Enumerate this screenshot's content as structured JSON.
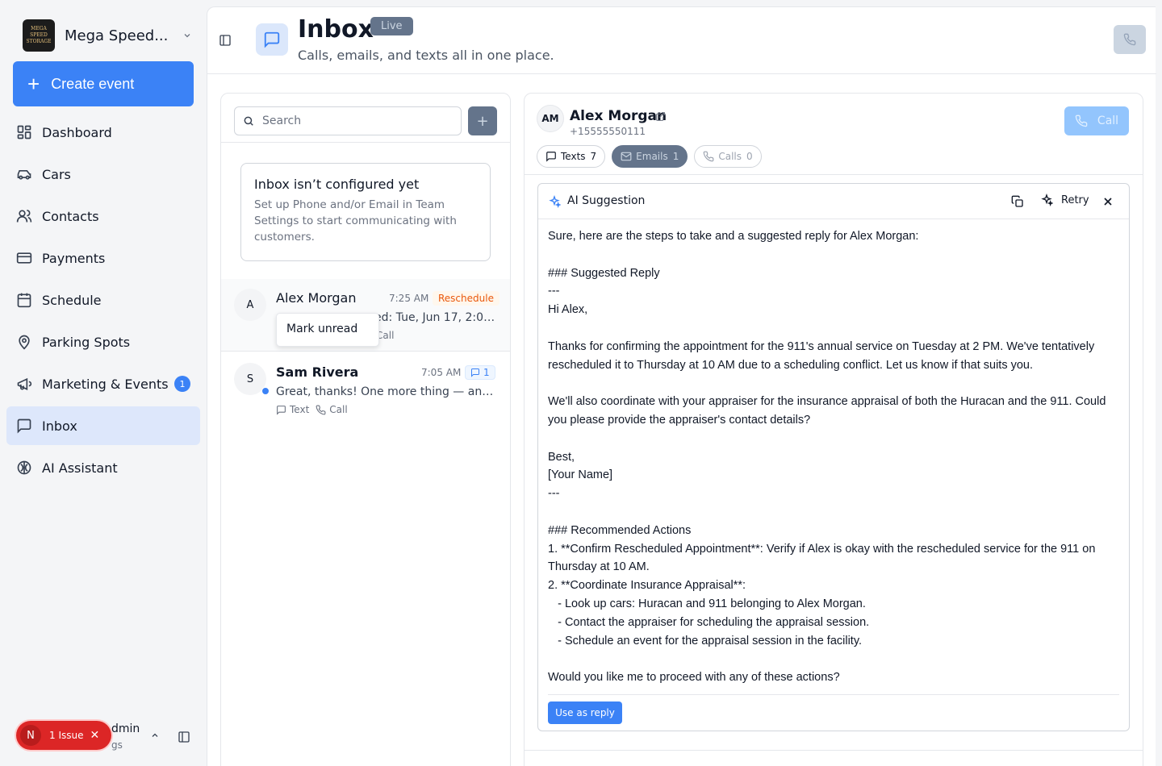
{
  "sidebar": {
    "brand_name": "Mega Speed...",
    "brand_logo_text": "MEGA SPEED STORAGE",
    "create_label": "Create event",
    "items": [
      {
        "label": "Dashboard",
        "icon": "dashboard-icon"
      },
      {
        "label": "Cars",
        "icon": "car-icon"
      },
      {
        "label": "Contacts",
        "icon": "contacts-icon"
      },
      {
        "label": "Payments",
        "icon": "credit-card-icon"
      },
      {
        "label": "Schedule",
        "icon": "calendar-icon"
      },
      {
        "label": "Parking Spots",
        "icon": "map-pin-icon"
      },
      {
        "label": "Marketing & Events",
        "icon": "megaphone-icon",
        "badge": "1"
      },
      {
        "label": "Inbox",
        "icon": "message-square-icon",
        "active": true
      },
      {
        "label": "AI Assistant",
        "icon": "brain-icon"
      }
    ],
    "issue": {
      "avatar": "N",
      "label": "1 Issue"
    },
    "user": {
      "name": "dmin",
      "sub": "gs"
    }
  },
  "header": {
    "title": "Inbox",
    "badge": "Live",
    "subtitle": "Calls, emails, and texts all in one place."
  },
  "list": {
    "search_placeholder": "Search",
    "add_label": "+",
    "config_card": {
      "title": "Inbox isn’t configured yet",
      "body": "Set up Phone and/or Email in Team Settings to start communicating with customers."
    },
    "conversations": [
      {
        "avatar": "A",
        "name": "Alex Morgan",
        "time": "7:25 AM",
        "tag": "Reschedule",
        "preview": "ed: Tue, Jun 17, 2:00 ...",
        "meta_fragment": "Call"
      },
      {
        "avatar": "S",
        "name": "Sam Rivera",
        "time": "7:05 AM",
        "count": "1",
        "preview": "Great, thanks! One more thing — any u...",
        "meta_text": "Text",
        "meta_call": "Call"
      }
    ],
    "context_menu": {
      "item": "Mark unread"
    }
  },
  "detail": {
    "avatar": "AM",
    "name": "Alex Morgan",
    "phone": "+15555550111",
    "call_label": "Call",
    "chips": [
      {
        "label": "Texts",
        "count": "7"
      },
      {
        "label": "Emails",
        "count": "1"
      },
      {
        "label": "Calls",
        "count": "0"
      }
    ],
    "ai": {
      "title": "AI Suggestion",
      "retry_label": "Retry",
      "use_label": "Use as reply",
      "text": "Sure, here are the steps to take and a suggested reply for Alex Morgan:\n\n### Suggested Reply\n---\nHi Alex,\n\nThanks for confirming the appointment for the 911's annual service on Tuesday at 2 PM. We've tentatively rescheduled it to Thursday at 10 AM due to a scheduling conflict. Let us know if that suits you.\n\nWe'll also coordinate with your appraiser for the insurance appraisal of both the Huracan and the 911. Could you please provide the appraiser's contact details?\n\nBest,\n[Your Name]\n---\n\n### Recommended Actions\n1. **Confirm Rescheduled Appointment**: Verify if Alex is okay with the rescheduled service for the 911 on Thursday at 10 AM.\n2. **Coordinate Insurance Appraisal**:\n   - Look up cars: Huracan and 911 belonging to Alex Morgan.\n   - Contact the appraiser for scheduling the appraisal session.\n   - Schedule an event for the appraisal session in the facility.\n\nWould you like me to proceed with any of these actions?"
    }
  },
  "colors": {
    "accent": "#3b82f6",
    "active_nav": "#dde7fb",
    "chip_active": "#64748b",
    "issue": "#dc2626",
    "reschedule": "#ea580c"
  }
}
